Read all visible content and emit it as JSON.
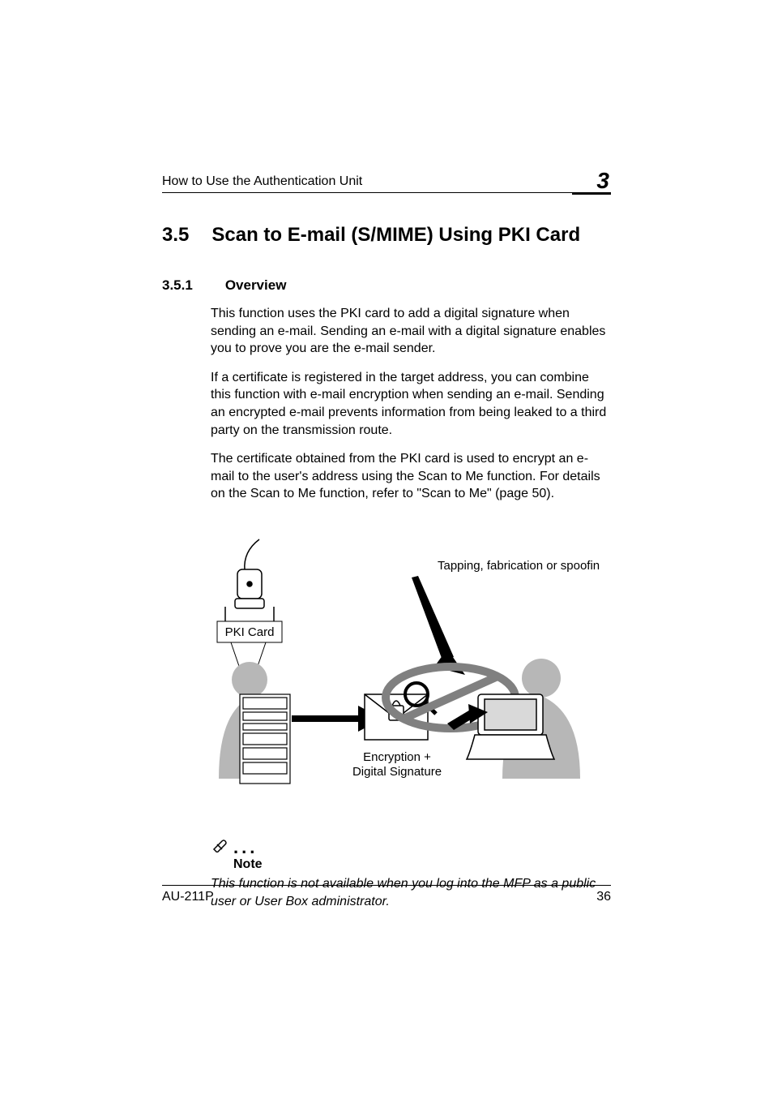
{
  "header": {
    "title": "How to Use the Authentication Unit",
    "chapter": "3"
  },
  "section": {
    "number": "3.5",
    "title": "Scan to E-mail (S/MIME) Using PKI Card"
  },
  "subsection": {
    "number": "3.5.1",
    "title": "Overview"
  },
  "paragraphs": {
    "p1": "This function uses the PKI card to add a digital signature when sending an e-mail. Sending an e-mail with a digital signature enables you to prove you are the e-mail sender.",
    "p2": "If a certificate is registered in the target address, you can combine this function with e-mail encryption when sending an e-mail. Sending an encrypted e-mail prevents information from being leaked to a third party on the transmission route.",
    "p3": "The certificate obtained from the PKI card is used to encrypt an e-mail to the user's address using the Scan to Me function. For details on the Scan to Me function, refer to \"Scan to Me\" (page 50)."
  },
  "diagram": {
    "pki_card": "PKI Card",
    "threat": "Tapping, fabrication or spoofing",
    "encryption_line1": "Encryption +",
    "encryption_line2": "Digital Signature"
  },
  "note": {
    "label": "Note",
    "text": "This function is not available when you log into the MFP as a public user or User Box administrator."
  },
  "footer": {
    "model": "AU-211P",
    "page": "36"
  }
}
